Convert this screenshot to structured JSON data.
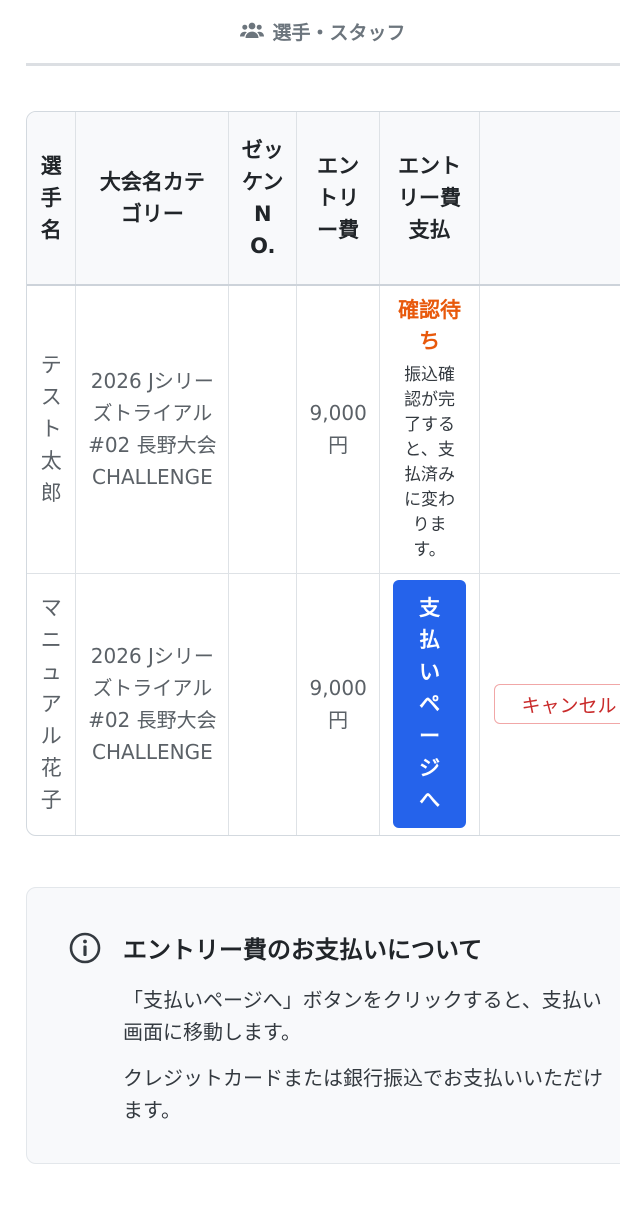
{
  "tab": {
    "label": "選手・スタッフ",
    "icon": "users-icon"
  },
  "table": {
    "headers": [
      "選手名",
      "大会名カテゴリー",
      "ゼッケンNO.",
      "エントリー費",
      "エントリー費支払",
      ""
    ],
    "rows": [
      {
        "player": "テスト太郎",
        "event": "2026 Jシリーズトライアル #02 長野大会",
        "category": "CHALLENGE",
        "bib": "",
        "fee": "9,000円",
        "status": "確認待ち",
        "status_note": "振込確認が完了すると、支払済みに変わります。"
      },
      {
        "player": "マニュアル花子",
        "event": "2026 Jシリーズトライアル #02 長野大会",
        "category": "CHALLENGE",
        "bib": "",
        "fee": "9,000円",
        "pay_button": "支払いページへ",
        "cancel_button": "キャンセル"
      }
    ]
  },
  "info": {
    "title": "エントリー費のお支払いについて",
    "lines": [
      "「支払いページへ」ボタンをクリックすると、支払い画面に移動します。",
      "クレジットカードまたは銀行振込でお支払いいただけます。"
    ],
    "icon": "info-icon"
  },
  "colors": {
    "primary": "#2563eb",
    "warning": "#e8590c",
    "danger": "#c92a2a",
    "muted": "#6c757d"
  }
}
